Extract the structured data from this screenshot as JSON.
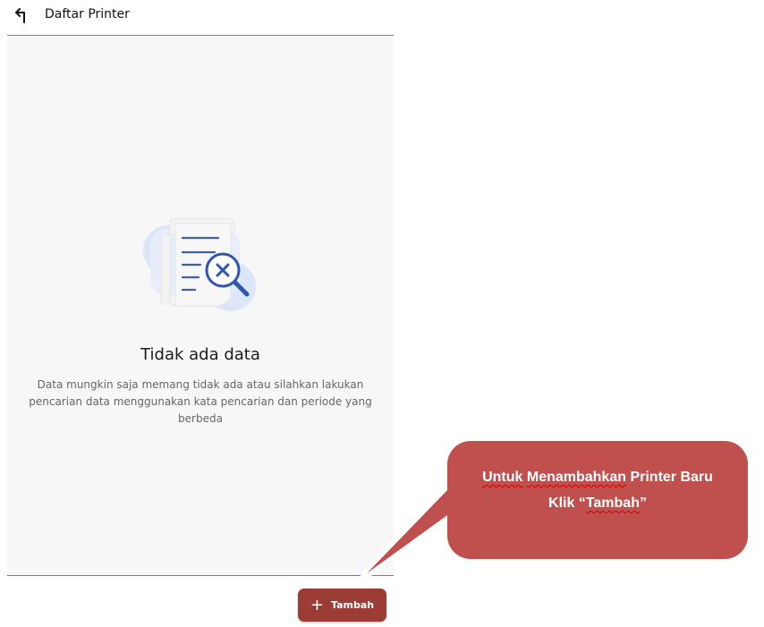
{
  "header": {
    "title": "Daftar Printer",
    "back_icon": "back-arrow-icon"
  },
  "empty_state": {
    "illustration_icon": "document-search-x-icon",
    "title": "Tidak ada data",
    "description": "Data mungkin saja memang tidak ada atau silahkan lakukan pencarian data menggunakan kata pencarian dan periode yang berbeda"
  },
  "actions": {
    "add_label": "Tambah",
    "add_icon": "plus-icon"
  },
  "callout": {
    "line1_word1": "Untuk",
    "line1_word2": "Menambahkan",
    "line1_rest": " Printer Baru",
    "line2_prefix": "Klik “",
    "line2_word": "Tambah",
    "line2_suffix": "”"
  },
  "colors": {
    "button": "#9c3d35",
    "callout": "#c0504d",
    "divider": "#7d7d7d",
    "content_bg": "#f7f7f7"
  }
}
